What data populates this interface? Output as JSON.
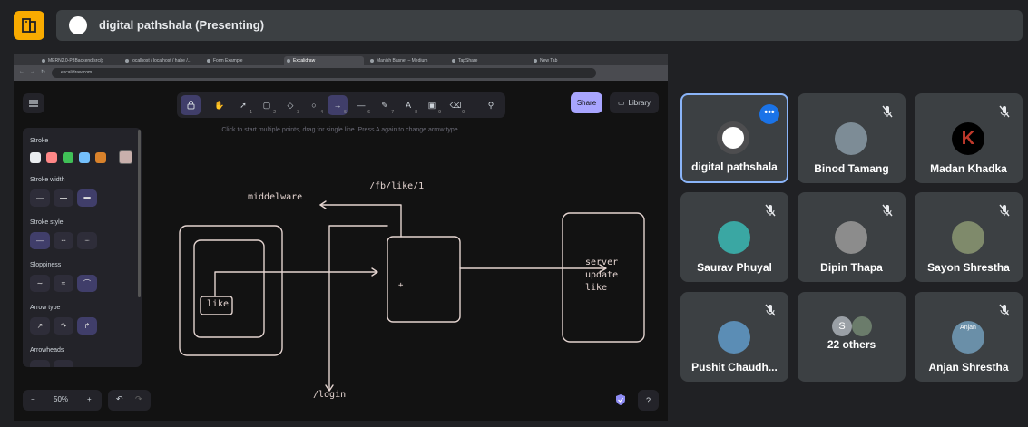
{
  "meeting": {
    "title": "digital pathshala (Presenting)"
  },
  "browser": {
    "tabs": [
      {
        "label": "MERN2.0-P3Backend/src/p..."
      },
      {
        "label": "localhost / localhost / hahe /..."
      },
      {
        "label": "Form Example"
      },
      {
        "label": "Excalidraw"
      },
      {
        "label": "Manish Basnet – Medium"
      },
      {
        "label": "TapShare"
      },
      {
        "label": "New Tab"
      }
    ],
    "url": "excalidraw.com"
  },
  "excalidraw": {
    "share_label": "Share",
    "library_label": "Library",
    "hint": "Click to start multiple points, drag for single line. Press A again to change arrow type.",
    "zoom_level": "50%",
    "tool_shortcuts": [
      "1",
      "2",
      "3",
      "4",
      "5",
      "6",
      "7",
      "8",
      "9",
      "0"
    ],
    "props": {
      "stroke_label": "Stroke",
      "stroke_width_label": "Stroke width",
      "stroke_style_label": "Stroke style",
      "sloppiness_label": "Sloppiness",
      "arrow_type_label": "Arrow type",
      "arrowheads_label": "Arrowheads",
      "stroke_colors": [
        "#e9ecef",
        "#ff8787",
        "#40c057",
        "#74c0fc",
        "#d9822b"
      ],
      "current_color": "#c9b0ac"
    },
    "drawing_texts": {
      "middleware": "middelware",
      "route_like": "/fb/like/1",
      "like": "like",
      "login": "/login",
      "server1": "server",
      "server2": "update",
      "server3": "like",
      "plus": "+"
    }
  },
  "participants": [
    {
      "name": "digital pathshala",
      "active": true,
      "muted": false,
      "avatar": "logo-avatar"
    },
    {
      "name": "Binod Tamang",
      "muted": true,
      "avatar": "photo-avatar"
    },
    {
      "name": "Madan Khadka",
      "muted": true,
      "avatar": "k-logo-avatar"
    },
    {
      "name": "Saurav Phuyal",
      "muted": true,
      "avatar": "photo-avatar"
    },
    {
      "name": "Dipin Thapa",
      "muted": true,
      "avatar": "photo-avatar"
    },
    {
      "name": "Sayon Shrestha",
      "muted": true,
      "avatar": "photo-avatar"
    },
    {
      "name": "Pushit Chaudh...",
      "muted": true,
      "avatar": "photo-avatar"
    },
    {
      "name": "22 others",
      "muted": false,
      "avatar": "group-avatar",
      "group_initial": "S"
    },
    {
      "name": "Anjan Shrestha",
      "muted": true,
      "avatar": "photo-avatar",
      "avatar_text": "Anjan"
    }
  ]
}
